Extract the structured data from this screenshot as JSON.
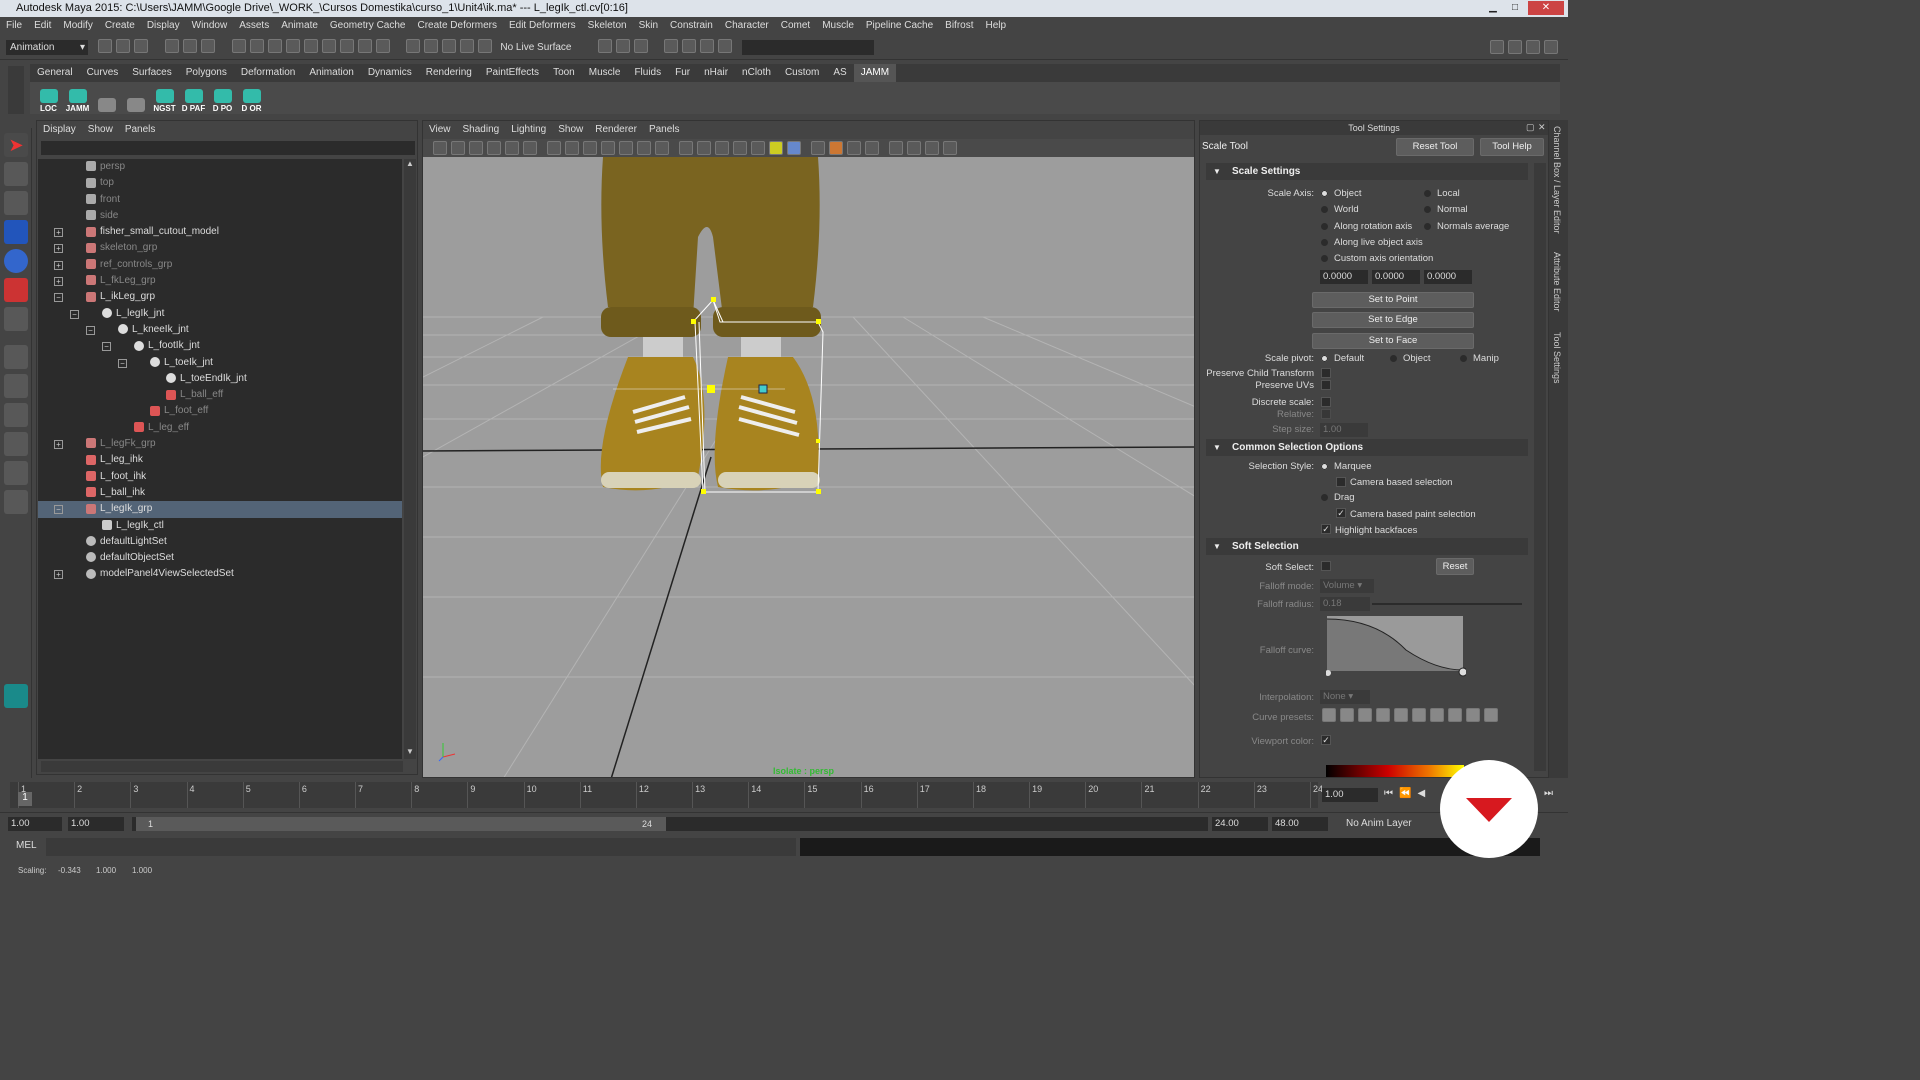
{
  "titlebar": {
    "title": "Autodesk Maya 2015: C:\\Users\\JAMM\\Google Drive\\_WORK_\\Cursos Domestika\\curso_1\\Unit4\\ik.ma*   ---   L_legIk_ctl.cv[0:16]"
  },
  "menubar": [
    "File",
    "Edit",
    "Modify",
    "Create",
    "Display",
    "Window",
    "Assets",
    "Animate",
    "Geometry Cache",
    "Create Deformers",
    "Edit Deformers",
    "Skeleton",
    "Skin",
    "Constrain",
    "Character",
    "Comet",
    "Muscle",
    "Pipeline Cache",
    "Bifrost",
    "Help"
  ],
  "statusline": {
    "mode": "Animation",
    "live_surface": "No Live Surface"
  },
  "shelf": {
    "tabs": [
      "General",
      "Curves",
      "Surfaces",
      "Polygons",
      "Deformation",
      "Animation",
      "Dynamics",
      "Rendering",
      "PaintEffects",
      "Toon",
      "Muscle",
      "Fluids",
      "Fur",
      "nHair",
      "nCloth",
      "Custom",
      "AS",
      "JAMM"
    ],
    "active_tab": "JAMM",
    "buttons": [
      "LOC",
      "JAMM",
      "",
      "",
      "NGST",
      "D PAF",
      "D PO",
      "D OR"
    ]
  },
  "outliner": {
    "menu": [
      "Display",
      "Show",
      "Panels"
    ],
    "items": [
      {
        "label": "persp",
        "indent": 0,
        "dim": true,
        "icon": "camera-icon"
      },
      {
        "label": "top",
        "indent": 0,
        "dim": true,
        "icon": "camera-icon"
      },
      {
        "label": "front",
        "indent": 0,
        "dim": true,
        "icon": "camera-icon"
      },
      {
        "label": "side",
        "indent": 0,
        "dim": true,
        "icon": "camera-icon"
      },
      {
        "label": "fisher_small_cutout_model",
        "indent": 0,
        "dim": false,
        "icon": "group-icon",
        "exp": "+"
      },
      {
        "label": "skeleton_grp",
        "indent": 0,
        "dim": true,
        "icon": "group-icon",
        "exp": "+"
      },
      {
        "label": "ref_controls_grp",
        "indent": 0,
        "dim": true,
        "icon": "group-icon",
        "exp": "+"
      },
      {
        "label": "L_fkLeg_grp",
        "indent": 0,
        "dim": true,
        "icon": "group-icon",
        "exp": "+"
      },
      {
        "label": "L_ikLeg_grp",
        "indent": 0,
        "dim": false,
        "icon": "group-icon",
        "exp": "-"
      },
      {
        "label": "L_legIk_jnt",
        "indent": 1,
        "dim": false,
        "icon": "joint-icon",
        "exp": "-"
      },
      {
        "label": "L_kneeIk_jnt",
        "indent": 2,
        "dim": false,
        "icon": "joint-icon",
        "exp": "-"
      },
      {
        "label": "L_footIk_jnt",
        "indent": 3,
        "dim": false,
        "icon": "joint-icon",
        "exp": "-"
      },
      {
        "label": "L_toeIk_jnt",
        "indent": 4,
        "dim": false,
        "icon": "joint-icon",
        "exp": "-"
      },
      {
        "label": "L_toeEndIk_jnt",
        "indent": 5,
        "dim": false,
        "icon": "joint-icon"
      },
      {
        "label": "L_ball_eff",
        "indent": 5,
        "dim": true,
        "icon": "effector-icon"
      },
      {
        "label": "L_foot_eff",
        "indent": 4,
        "dim": true,
        "icon": "effector-icon"
      },
      {
        "label": "L_leg_eff",
        "indent": 3,
        "dim": true,
        "icon": "effector-icon"
      },
      {
        "label": "L_legFk_grp",
        "indent": 0,
        "dim": true,
        "icon": "group-icon",
        "exp": "+"
      },
      {
        "label": "L_leg_ihk",
        "indent": 0,
        "dim": false,
        "icon": "ik-handle-icon"
      },
      {
        "label": "L_foot_ihk",
        "indent": 0,
        "dim": false,
        "icon": "ik-handle-icon"
      },
      {
        "label": "L_ball_ihk",
        "indent": 0,
        "dim": false,
        "icon": "ik-handle-icon"
      },
      {
        "label": "L_legIk_grp",
        "indent": 0,
        "dim": false,
        "icon": "group-icon",
        "exp": "-",
        "sel": true
      },
      {
        "label": "L_legIk_ctl",
        "indent": 1,
        "dim": false,
        "icon": "curve-icon"
      },
      {
        "label": "defaultLightSet",
        "indent": 0,
        "dim": false,
        "icon": "set-icon"
      },
      {
        "label": "defaultObjectSet",
        "indent": 0,
        "dim": false,
        "icon": "set-icon"
      },
      {
        "label": "modelPanel4ViewSelectedSet",
        "indent": 0,
        "dim": false,
        "icon": "set-icon",
        "exp": "+"
      }
    ]
  },
  "viewport": {
    "menu": [
      "View",
      "Shading",
      "Lighting",
      "Show",
      "Renderer",
      "Panels"
    ],
    "isolate_label": "Isolate : persp"
  },
  "tool_settings": {
    "header": "Tool Settings",
    "tool_name": "Scale Tool",
    "reset_tool": "Reset Tool",
    "tool_help": "Tool Help",
    "scale_settings": {
      "title": "Scale Settings",
      "scale_axis_label": "Scale Axis:",
      "axis_options": [
        "Object",
        "Local",
        "World",
        "Normal",
        "Along rotation axis",
        "Normals average",
        "Along live object axis",
        "Custom axis orientation"
      ],
      "axis_values": [
        "0.0000",
        "0.0000",
        "0.0000"
      ],
      "set_to_point": "Set to Point",
      "set_to_edge": "Set to Edge",
      "set_to_face": "Set to Face",
      "scale_pivot_label": "Scale pivot:",
      "pivot_options": [
        "Default",
        "Object",
        "Manip"
      ],
      "preserve_child": "Preserve Child Transform",
      "preserve_uvs": "Preserve UVs",
      "discrete_scale": "Discrete scale:",
      "relative": "Relative:",
      "step_size_label": "Step size:",
      "step_size": "1.00"
    },
    "common_selection": {
      "title": "Common Selection Options",
      "selection_style": "Selection Style:",
      "marquee": "Marquee",
      "camera_based_selection": "Camera based selection",
      "drag": "Drag",
      "camera_based_paint": "Camera based paint selection",
      "highlight_backfaces": "Highlight backfaces"
    },
    "soft_selection": {
      "title": "Soft Selection",
      "soft_select": "Soft Select:",
      "reset": "Reset",
      "falloff_mode_label": "Falloff mode:",
      "falloff_mode": "Volume",
      "falloff_radius_label": "Falloff radius:",
      "falloff_radius": "0.18",
      "falloff_curve": "Falloff curve:",
      "interpolation_label": "Interpolation:",
      "interpolation": "None",
      "curve_presets": "Curve presets:",
      "viewport_color": "Viewport color:"
    },
    "side_tabs": [
      "Channel Box / Layer Editor",
      "Attribute Editor",
      "Tool Settings"
    ]
  },
  "timeline": {
    "ticks": [
      "1",
      "2",
      "3",
      "4",
      "5",
      "6",
      "7",
      "8",
      "9",
      "10",
      "11",
      "12",
      "13",
      "14",
      "15",
      "16",
      "17",
      "18",
      "19",
      "20",
      "21",
      "22",
      "23",
      "24"
    ],
    "current_frame": "1.00",
    "range_start": "1.00",
    "range_start2": "1.00",
    "range_slider_start": "1",
    "range_slider_end": "24",
    "range_end": "24.00",
    "range_end2": "48.00",
    "anim_layer": "No Anim Layer"
  },
  "cmdline": {
    "label": "MEL"
  },
  "helpline": {
    "label": "Scaling:",
    "x": "-0.343",
    "y": "1.000",
    "z": "1.000"
  },
  "colors": {
    "accent_selection": "#536477",
    "logo_red": "#d7191f",
    "jamm_teal": "#33aaaa"
  }
}
